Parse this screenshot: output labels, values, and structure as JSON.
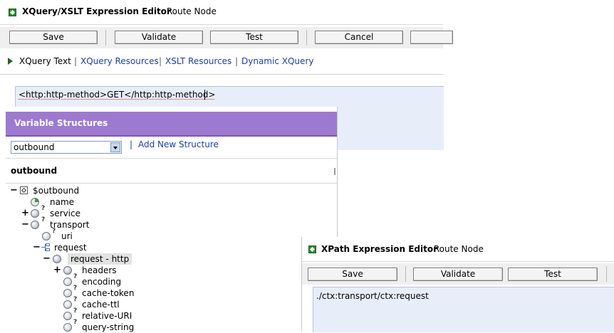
{
  "xquery": {
    "title": "XQuery/XSLT Expression Editor",
    "subtitle": ": Route Node",
    "buttons": {
      "save": "Save",
      "validate": "Validate",
      "test": "Test",
      "cancel": "Cancel"
    },
    "tabs": {
      "text": "XQuery Text",
      "resources": "XQuery Resources",
      "xslt": "XSLT Resources",
      "dynamic": "Dynamic XQuery",
      "sep": "|"
    },
    "expression": "<http:http-method>GET</http:http-method>"
  },
  "variables": {
    "header": "Variable Structures",
    "selected": "outbound",
    "add_new": "Add New Structure",
    "sep": "|",
    "tree_title": "outbound",
    "tree": {
      "root": "$outbound",
      "name": "name",
      "service": "service",
      "transport": "transport",
      "uri": "uri",
      "request": "request",
      "request_http": "request - http",
      "headers": "headers",
      "encoding": "encoding",
      "cache_token": "cache-token",
      "cache_ttl": "cache-ttl",
      "relative_uri": "relative-URI",
      "query_string": "query-string"
    },
    "glyphs": {
      "plus": "+",
      "minus": "−",
      "q": "?"
    }
  },
  "xpath": {
    "title": "XPath Expression Editor",
    "subtitle": ": Route Node",
    "buttons": {
      "save": "Save",
      "validate": "Validate",
      "test": "Test"
    },
    "expression": "./ctx:transport/ctx:request"
  },
  "colors": {
    "header_purple": "#9c7ad0",
    "link": "#1d3fa6",
    "editor_bg": "#e8eef9"
  }
}
